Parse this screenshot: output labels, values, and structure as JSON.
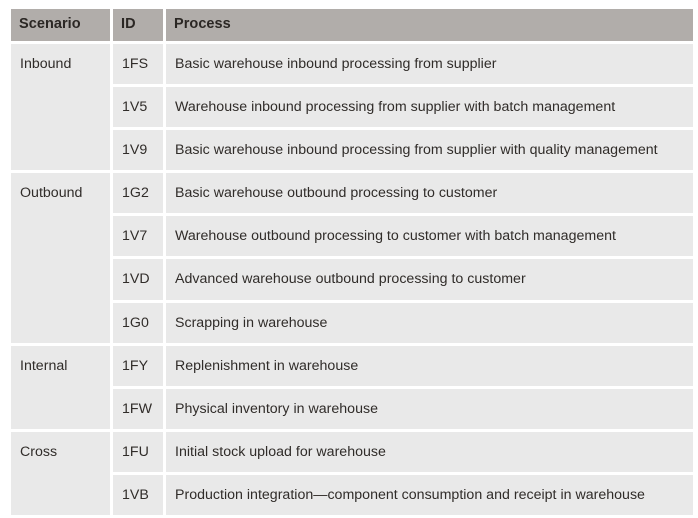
{
  "table": {
    "columns": [
      {
        "key": "scenario",
        "label": "Scenario"
      },
      {
        "key": "id",
        "label": "ID"
      },
      {
        "key": "process",
        "label": "Process"
      }
    ],
    "groups": [
      {
        "scenario": "Inbound",
        "rows": [
          {
            "id": "1FS",
            "process": "Basic warehouse inbound processing from supplier"
          },
          {
            "id": "1V5",
            "process": "Warehouse inbound processing from supplier with batch management"
          },
          {
            "id": "1V9",
            "process": "Basic warehouse inbound processing from supplier with quality management"
          }
        ]
      },
      {
        "scenario": "Outbound",
        "rows": [
          {
            "id": "1G2",
            "process": "Basic warehouse outbound processing to customer"
          },
          {
            "id": "1V7",
            "process": "Warehouse outbound processing to customer with batch management"
          },
          {
            "id": "1VD",
            "process": "Advanced warehouse outbound processing to customer"
          },
          {
            "id": "1G0",
            "process": "Scrapping in warehouse"
          }
        ]
      },
      {
        "scenario": "Internal",
        "rows": [
          {
            "id": "1FY",
            "process": "Replenishment in warehouse"
          },
          {
            "id": "1FW",
            "process": "Physical inventory in warehouse"
          }
        ]
      },
      {
        "scenario": "Cross",
        "rows": [
          {
            "id": "1FU",
            "process": "Initial stock upload for warehouse"
          },
          {
            "id": "1VB",
            "process": "Production integration—component consumption and receipt in warehouse"
          }
        ]
      }
    ]
  },
  "colors": {
    "header_background": "#b1adaa",
    "cell_background": "#e9e9e9",
    "page_background": "#ffffff",
    "header_text": "#2b2724",
    "cell_text": "#302c29"
  }
}
